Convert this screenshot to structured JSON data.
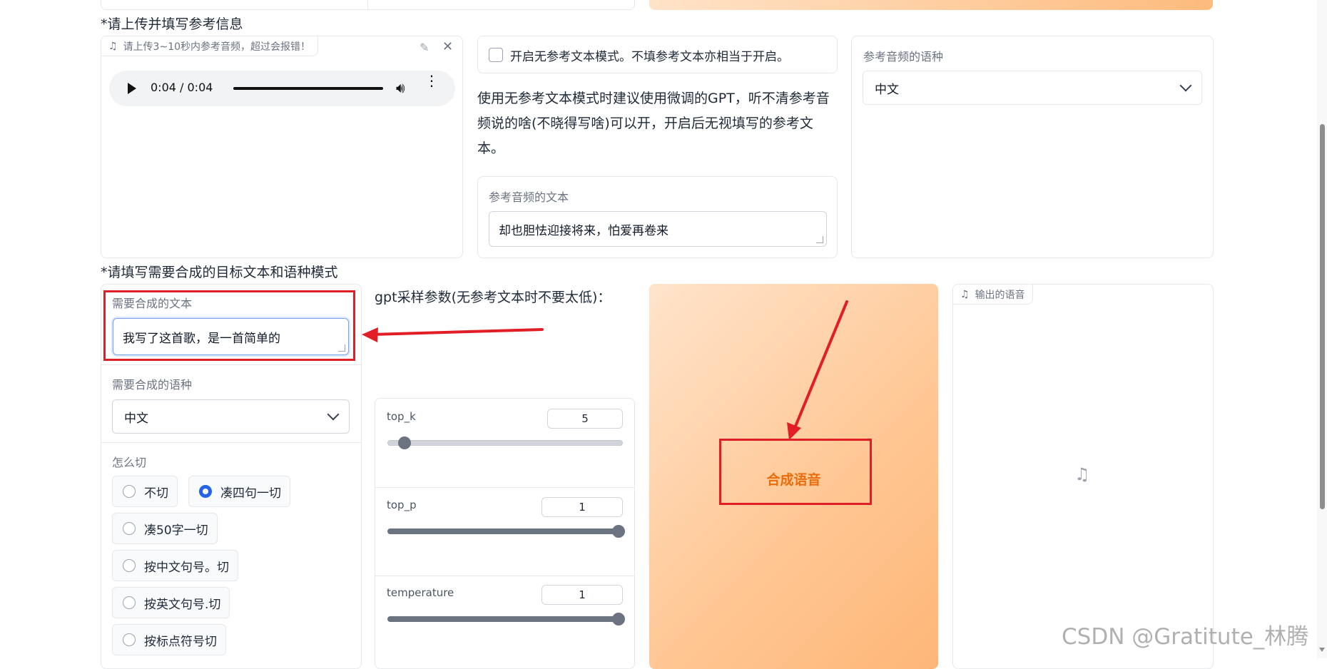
{
  "colors": {
    "accent": "#2563eb",
    "orange_text": "#ea6c0a",
    "red_annotation": "#e11d25",
    "orange_top": "#ffd7b0",
    "orange_bottom": "#fdba7a"
  },
  "ref_section": {
    "title": "*请上传并填写参考信息",
    "audio_upload_label": "请上传3~10秒内参考音频，超过会报错！",
    "audio_time": "0:04 / 0:04",
    "no_ref_checkbox_label": "开启无参考文本模式。不填参考文本亦相当于开启。",
    "no_ref_hint": "使用无参考文本模式时建议使用微调的GPT，听不清参考音频说的啥(不晓得写啥)可以开，开启后无视填写的参考文本。",
    "ref_text_label": "参考音频的文本",
    "ref_text_value": "却也胆怯迎接将来，怕爱再卷来",
    "ref_lang_label": "参考音频的语种",
    "ref_lang_value": "中文"
  },
  "target_section": {
    "title": "*请填写需要合成的目标文本和语种模式",
    "text_label": "需要合成的文本",
    "text_value": "我写了这首歌，是一首简单的",
    "lang_label": "需要合成的语种",
    "lang_value": "中文",
    "split_label": "怎么切",
    "split_options": [
      "不切",
      "凑四句一切",
      "凑50字一切",
      "按中文句号。切",
      "按英文句号.切",
      "按标点符号切"
    ],
    "split_selected": "凑四句一切"
  },
  "gpt_params": {
    "title": "gpt采样参数(无参考文本时不要太低)：",
    "top_k": {
      "label": "top_k",
      "value": "5",
      "fraction": 0.04
    },
    "top_p": {
      "label": "top_p",
      "value": "1",
      "fraction": 1.0
    },
    "temperature": {
      "label": "temperature",
      "value": "1",
      "fraction": 1.0
    }
  },
  "synth_button_label": "合成语音",
  "output_label": "输出的语音",
  "watermark": "CSDN @Gratitute_林腾"
}
